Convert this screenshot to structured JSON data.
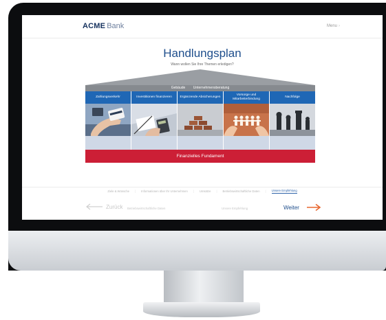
{
  "app": {
    "brand_strong": "ACME",
    "brand_light": "Bank",
    "menu_label": "Menu",
    "menu_chevron": "›"
  },
  "page": {
    "title": "Handlungsplan",
    "subtitle": "Wann wollen Sie Ihre Themen erledigen?"
  },
  "roof": {
    "items": [
      "Gebäude",
      "Unternehmensberatung"
    ]
  },
  "pillars": [
    {
      "label": "Zahlungsverkehr",
      "image": "hand-with-payment-card-image"
    },
    {
      "label": "Investitionen finanzieren",
      "image": "desk-with-calculator-image"
    },
    {
      "label": "Ergänzende Absicherungen",
      "image": "stacked-blocks-image"
    },
    {
      "label": "Vorsorge und Mitarbeiterbindung",
      "image": "paper-people-chain-image"
    },
    {
      "label": "Nachfolge",
      "image": "chess-pieces-image"
    }
  ],
  "foundation": {
    "label": "Finanzielles Fundament"
  },
  "steps": [
    {
      "label": "Ziele & Wünsche",
      "active": false
    },
    {
      "label": "Informationen über Ihr Unternehmen",
      "active": false
    },
    {
      "label": "Umsätze",
      "active": false
    },
    {
      "label": "Betriebswirtschaftliche Daten",
      "active": false
    },
    {
      "label": "Unsere Empfehlung",
      "active": true
    }
  ],
  "nav": {
    "back_label": "Zurück",
    "back_hint": "Betriebswirtschaftliche Daten",
    "next_label": "Weiter",
    "next_hint": "Unsere Empfehlung",
    "back_icon": "arrow-left-icon",
    "next_icon": "arrow-right-icon"
  },
  "colors": {
    "brand_blue": "#1e4e8c",
    "pillar_blue": "#1f67b5",
    "foundation_red": "#cc1f36",
    "next_arrow": "#e8672e"
  }
}
